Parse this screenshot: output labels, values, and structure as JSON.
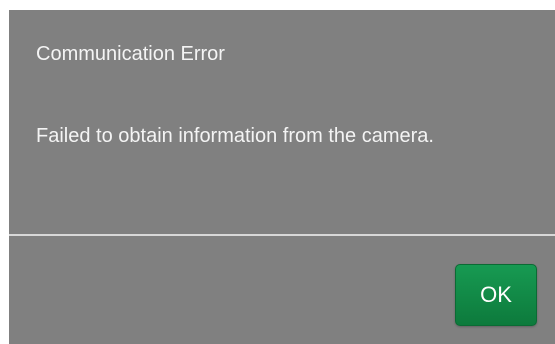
{
  "dialog": {
    "title": "Communication Error",
    "message": "Failed to obtain information from the camera.",
    "ok_label": "OK"
  },
  "colors": {
    "dialog_background": "#808080",
    "ok_button": "#138a47"
  }
}
